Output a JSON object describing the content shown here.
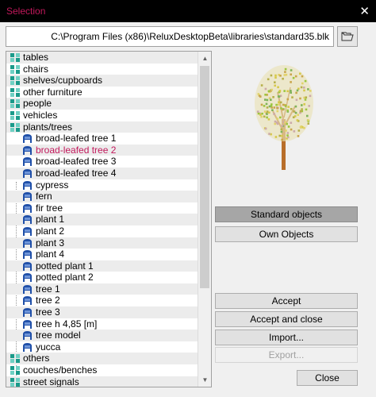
{
  "window": {
    "title": "Selection",
    "close_glyph": "✕"
  },
  "path": {
    "value": "C:\\Program Files (x86)\\ReluxDesktopBeta\\libraries\\standard35.blk"
  },
  "tree": {
    "items": [
      {
        "label": "tables",
        "level": 0,
        "icon": "category-icon"
      },
      {
        "label": "chairs",
        "level": 0,
        "icon": "category-icon"
      },
      {
        "label": "shelves/cupboards",
        "level": 0,
        "icon": "category-icon"
      },
      {
        "label": "other furniture",
        "level": 0,
        "icon": "category-icon"
      },
      {
        "label": "people",
        "level": 0,
        "icon": "category-icon"
      },
      {
        "label": "vehicles",
        "level": 0,
        "icon": "category-icon"
      },
      {
        "label": "plants/trees",
        "level": 0,
        "icon": "category-icon"
      },
      {
        "label": "broad-leafed tree 1",
        "level": 1,
        "icon": "object-icon"
      },
      {
        "label": "broad-leafed tree 2",
        "level": 1,
        "icon": "object-icon",
        "selected": true
      },
      {
        "label": "broad-leafed tree 3",
        "level": 1,
        "icon": "object-icon"
      },
      {
        "label": "broad-leafed tree 4",
        "level": 1,
        "icon": "object-icon"
      },
      {
        "label": "cypress",
        "level": 1,
        "icon": "object-icon"
      },
      {
        "label": "fern",
        "level": 1,
        "icon": "object-icon"
      },
      {
        "label": "fir tree",
        "level": 1,
        "icon": "object-icon"
      },
      {
        "label": "plant 1",
        "level": 1,
        "icon": "object-icon"
      },
      {
        "label": "plant 2",
        "level": 1,
        "icon": "object-icon"
      },
      {
        "label": "plant 3",
        "level": 1,
        "icon": "object-icon"
      },
      {
        "label": "plant 4",
        "level": 1,
        "icon": "object-icon"
      },
      {
        "label": "potted plant 1",
        "level": 1,
        "icon": "object-icon"
      },
      {
        "label": "potted plant 2",
        "level": 1,
        "icon": "object-icon"
      },
      {
        "label": "tree 1",
        "level": 1,
        "icon": "object-icon"
      },
      {
        "label": "tree 2",
        "level": 1,
        "icon": "object-icon"
      },
      {
        "label": "tree 3",
        "level": 1,
        "icon": "object-icon"
      },
      {
        "label": "tree h 4,85 [m]",
        "level": 1,
        "icon": "object-icon"
      },
      {
        "label": "tree model",
        "level": 1,
        "icon": "object-icon"
      },
      {
        "label": "yucca",
        "level": 1,
        "icon": "object-icon"
      },
      {
        "label": "others",
        "level": 0,
        "icon": "category-icon"
      },
      {
        "label": "couches/benches",
        "level": 0,
        "icon": "category-icon"
      },
      {
        "label": "street signals",
        "level": 0,
        "icon": "category-icon"
      }
    ]
  },
  "buttons": {
    "standard_objects": "Standard objects",
    "own_objects": "Own Objects",
    "accept": "Accept",
    "accept_and_close": "Accept and close",
    "import": "Import...",
    "export": "Export...",
    "close": "Close"
  },
  "colors": {
    "title_text": "#c2185b",
    "selected_text": "#c2185b",
    "category_icon": "#1a9a8a",
    "object_icon": "#1f4fa8",
    "active_button": "#a6a6a6"
  }
}
